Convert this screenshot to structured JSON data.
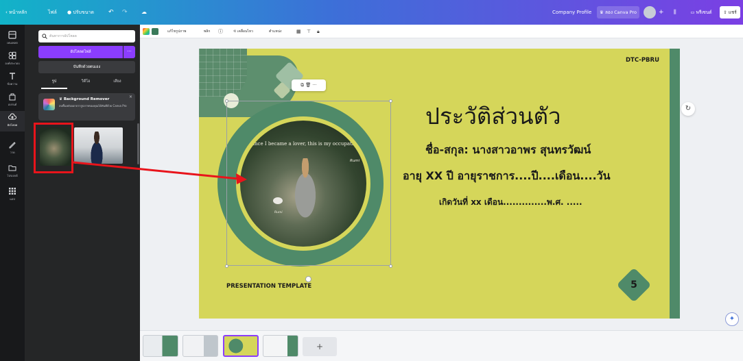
{
  "topbar": {
    "back_label": "หน้าหลัก",
    "file_label": "ไฟล์",
    "resize_label": "ปรับขนาด",
    "doc_title": "Company Profile",
    "try_pro_label": "ลอง Canva Pro",
    "share_label": "แชร์",
    "present_label": "พรีเซนต์"
  },
  "rail": {
    "items": [
      {
        "label": "เทมเพลต"
      },
      {
        "label": "องค์ประกอบ"
      },
      {
        "label": "ข้อความ"
      },
      {
        "label": "แบรนด์"
      },
      {
        "label": "อัปโหลด"
      },
      {
        "label": "วาด"
      },
      {
        "label": "โปรเจกต์"
      },
      {
        "label": "แอป"
      }
    ]
  },
  "panel": {
    "search_placeholder": "ค้นหาการอัปโหลด",
    "upload_label": "อัปโหลดไฟล์",
    "upload_more": "···",
    "record_label": "บันทึกด้วยตนเอง",
    "tabs": [
      "รูป",
      "วิดีโอ",
      "เสียง"
    ],
    "promo_title": "Background Remover",
    "promo_desc": "ลบพื้นหลังออกจากรูปภาพของคุณได้ทันทีด้วย Canva Pro",
    "promo_close": "×"
  },
  "toolbar": {
    "edit_image": "แก้ไขรูปภาพ",
    "crop": "พลิก",
    "animate": "เคลื่อนไหว",
    "position": "ตำแหน่ง"
  },
  "slide": {
    "brand": "DTC-PBRU",
    "title": "ประวัติส่วนตัว",
    "name_line": "ชื่อ-สกุล: นางสาวอาพร สุนทรวัฒน์",
    "age_line": "อายุ  XX  ปี อายุราชการ....ปี....เดือน....วัน",
    "birth_line": "เกิดวันที่ xx เดือน..............พ.ศ. .....",
    "footer": "PRESENTATION TEMPLATE",
    "page_number": "5",
    "photo_caption": "Since I became a lover, this is my occupation",
    "photo_sig": "Rumi",
    "photo_sig2": "Rumi",
    "corner_script": "text"
  },
  "float_toolbar": {
    "label": "⧉ 🗑 ···"
  },
  "pages": {
    "add_label": "+"
  },
  "colors": {
    "slide_bg": "#d5d65a",
    "accent_green": "#4f8a69",
    "brand_purple": "#8b3dff",
    "annotation_red": "#e8141b"
  }
}
